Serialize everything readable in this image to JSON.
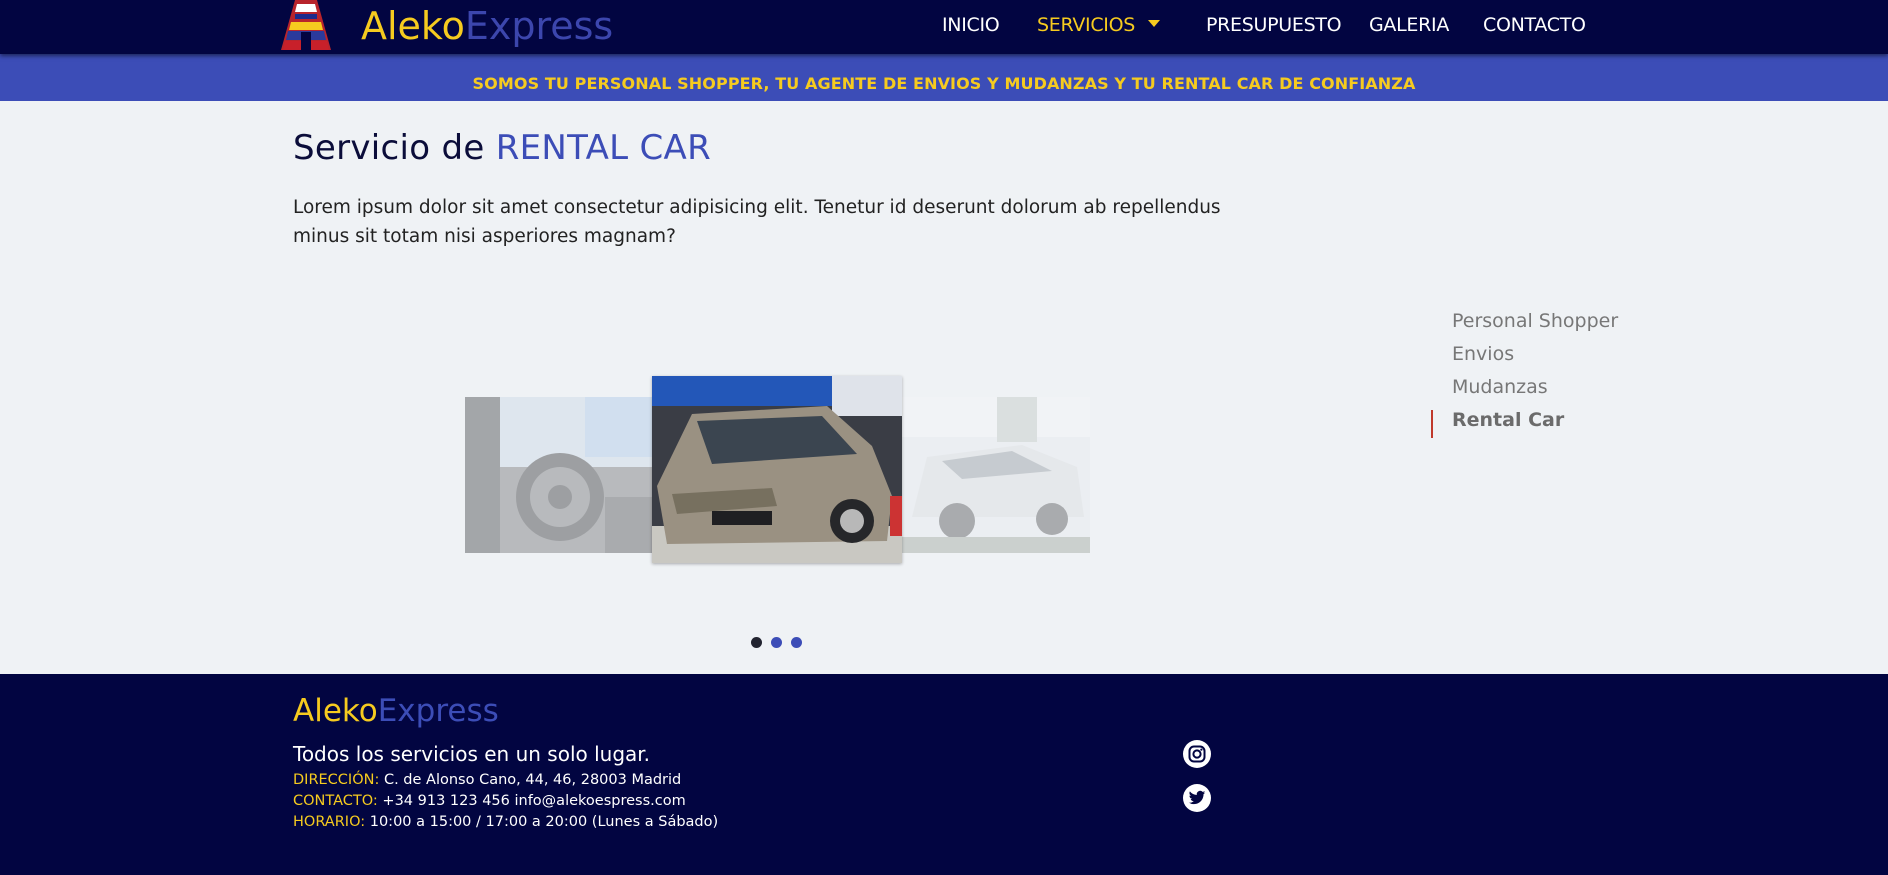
{
  "brand": {
    "part1": "Aleko",
    "part2": "Express"
  },
  "nav": {
    "inicio": "INICIO",
    "servicios": "SERVICIOS",
    "presupuesto": "PRESUPUESTO",
    "galeria": "GALERIA",
    "contacto": "CONTACTO"
  },
  "banner": "SOMOS TU PERSONAL SHOPPER, TU AGENTE DE ENVIOS Y MUDANZAS Y TU RENTAL CAR DE CONFIANZA",
  "main": {
    "title_prefix": "Servicio de",
    "title_highlight": "RENTAL CAR",
    "intro": "Lorem ipsum dolor sit amet consectetur adipisicing elit. Tenetur id deserunt dolorum ab repellendus minus sit totam nisi asperiores magnam?"
  },
  "side_menu": {
    "items": [
      "Personal Shopper",
      "Envios",
      "Mudanzas",
      "Rental Car"
    ],
    "active_index": 3
  },
  "carousel": {
    "slides": [
      "car-interior-image",
      "car-front-image",
      "white-minivan-image"
    ],
    "active_index": 1
  },
  "footer": {
    "brand_part1": "Aleko",
    "brand_part2": "Express",
    "tagline": "Todos los servicios en un solo lugar.",
    "address_label": "DIRECCIÓN:",
    "address": "C. de Alonso Cano, 44, 46, 28003 Madrid",
    "contact_label": "CONTACTO:",
    "contact": "+34 913 123 456 info@alekoespress.com",
    "hours_label": "HORARIO:",
    "hours": "10:00 a 15:00 / 17:00 a 20:00 (Lunes a Sábado)",
    "social_icons": [
      "instagram-icon",
      "twitter-icon"
    ]
  },
  "colors": {
    "navy": "#020541",
    "accent_yellow": "#f6cb1f",
    "accent_blue": "#3c4db7",
    "page_bg": "#eff2f5",
    "side_active_marker": "#c0392b"
  }
}
